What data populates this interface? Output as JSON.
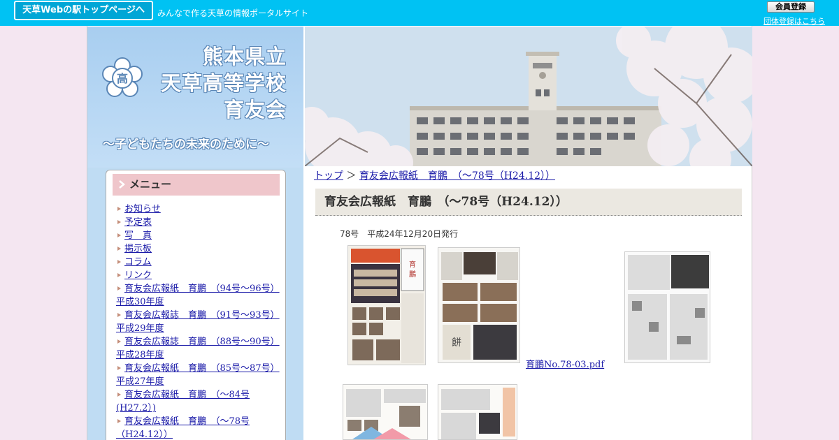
{
  "topbar": {
    "home_button": "天草Webの駅トップページへ",
    "tagline": "みんなで作る天草の情報ポータルサイト",
    "member_button": "会員登録",
    "group_link": "団体登録はこちら"
  },
  "header": {
    "title_lines": [
      "熊本県立",
      "天草高等学校",
      "育友会"
    ],
    "slogan": "〜子どもたちの未来のために〜"
  },
  "sidebar": {
    "menu_title": "メニュー",
    "items": [
      {
        "label": "お知らせ"
      },
      {
        "label": "予定表"
      },
      {
        "label": "写　真"
      },
      {
        "label": "掲示板"
      },
      {
        "label": "コラム"
      },
      {
        "label": "リンク"
      },
      {
        "label": "育友会広報紙　育鵬　（94号～96号）",
        "label2": "平成30年度"
      },
      {
        "label": "育友会広報誌　育鵬　（91号～93号）",
        "label2": "平成29年度"
      },
      {
        "label": "育友会広報誌　育鵬　（88号～90号）",
        "label2": "平成28年度"
      },
      {
        "label": "育友会広報紙　育鵬　（85号～87号）",
        "label2": "平成27年度"
      },
      {
        "label": "育友会広報紙　育鵬　（～84号",
        "label2": "(H27.2）)"
      },
      {
        "label": "育友会広報紙　育鵬　（～78号",
        "label2": "（H24.12））"
      }
    ]
  },
  "breadcrumb": {
    "top": "トップ",
    "separator": "＞",
    "current": "育友会広報紙　育鵬　（～78号（H24.12））"
  },
  "main": {
    "page_title": "育友会広報紙　育鵬　（～78号（H24.12））",
    "issue_note": "78号　平成24年12月20日発行",
    "pdf_link": "育鵬No.78-03.pdf"
  },
  "colors": {
    "topbar": "#00c2f3",
    "page_bg": "#f4e6f1",
    "sidebar_bg": "#bfdcf3",
    "menu_head": "#efc6cb",
    "title_bg": "#ebe8e1",
    "link": "#1a1aa8"
  }
}
